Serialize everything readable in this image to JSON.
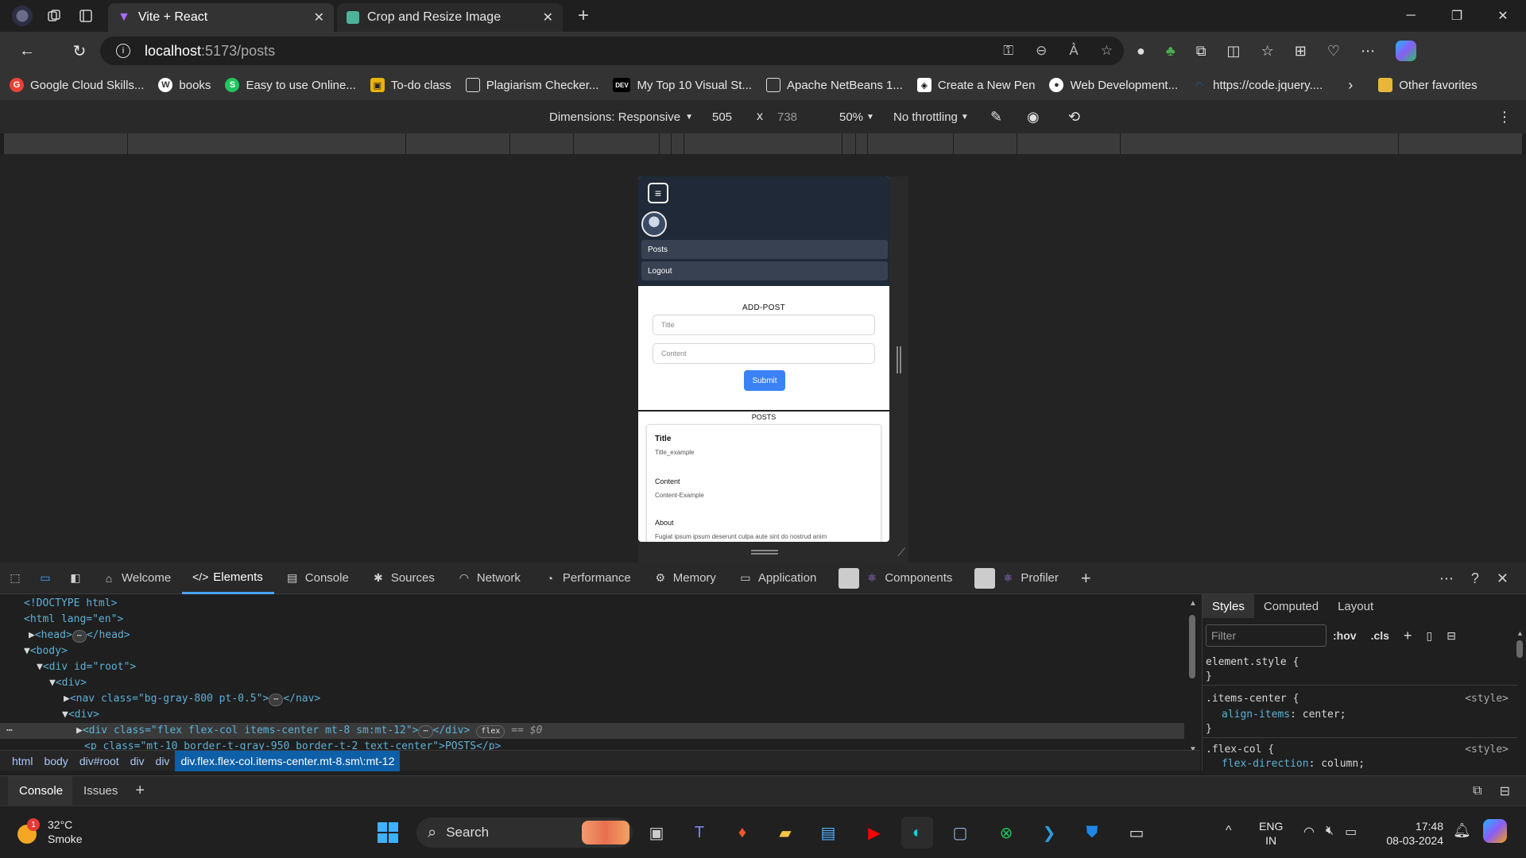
{
  "browser": {
    "tabs": [
      {
        "title": "Vite + React",
        "active": true
      },
      {
        "title": "Crop and Resize Image",
        "active": false
      }
    ],
    "url_host": "localhost",
    "url_path": ":5173/posts",
    "bookmarks": [
      "Google Cloud Skills...",
      "books",
      "Easy to use Online...",
      "To-do class",
      "Plagiarism Checker...",
      "My Top 10 Visual St...",
      "Apache NetBeans 1...",
      "Create a New Pen",
      "Web Development...",
      "https://code.jquery...."
    ],
    "other_favorites": "Other favorites"
  },
  "device_toolbar": {
    "dimensions": "Dimensions: Responsive",
    "width": "505",
    "times": "x",
    "height": "738",
    "zoom": "50%",
    "throttling": "No throttling"
  },
  "app": {
    "nav_items": [
      "Posts",
      "Logout"
    ],
    "add_post_title": "ADD-POST",
    "title_placeholder": "Title",
    "content_placeholder": "Content",
    "submit_label": "Submit",
    "posts_title": "POSTS",
    "post": {
      "title_label": "Title",
      "title_value": "Title_example",
      "content_label": "Content",
      "content_value": "Content-Example",
      "about_label": "About",
      "about_value": "Fugiat ipsum ipsum deserunt culpa aute sint do nostrud anim"
    }
  },
  "devtools": {
    "tabs": [
      "Welcome",
      "Elements",
      "Console",
      "Sources",
      "Network",
      "Performance",
      "Memory",
      "Application",
      "Components",
      "Profiler"
    ],
    "active_tab": "Elements",
    "dom_lines": {
      "doctype": "<!DOCTYPE html>",
      "html_open": "<html lang=\"en\">",
      "head": "<head>",
      "head_close": "</head>",
      "body": "<body>",
      "root": "<div id=\"root\">",
      "div1": "<div>",
      "nav": "<nav class=\"bg-gray-800 pt-0.5\">",
      "nav_close": "</nav>",
      "div2": "<div>",
      "selected_div": "<div class=\"flex flex-col items-center mt-8 sm:mt-12\">",
      "selected_close": "</div>",
      "flex_badge": "flex",
      "eq": "== $0",
      "p_line": "<p class=\"mt-10 border-t-gray-950 border-t-2 text-center\">POSTS</p>"
    },
    "breadcrumbs": [
      "html",
      "body",
      "div#root",
      "div",
      "div",
      "div.flex.flex-col.items-center.mt-8.sm\\:mt-12"
    ],
    "styles_tabs": [
      "Styles",
      "Computed",
      "Layout"
    ],
    "filter_placeholder": "Filter",
    "hov": ":hov",
    "cls": ".cls",
    "css": {
      "element_style": "element.style {",
      "close": "}",
      "items_center": ".items-center {",
      "items_center_prop": "align-items",
      "items_center_val": "center;",
      "flex_col": ".flex-col {",
      "flex_col_prop": "flex-direction",
      "flex_col_val": "column;",
      "source": "<style>"
    },
    "drawer_tabs": [
      "Console",
      "Issues"
    ]
  },
  "taskbar": {
    "weather_temp": "32°C",
    "weather_desc": "Smoke",
    "weather_badge": "1",
    "search_label": "Search",
    "lang": "ENG",
    "region": "IN",
    "time": "17:48",
    "date": "08-03-2024"
  },
  "colors": {
    "accent": "#4aa3ff",
    "submit": "#3b82f6",
    "nav_bg": "#1f2937"
  }
}
